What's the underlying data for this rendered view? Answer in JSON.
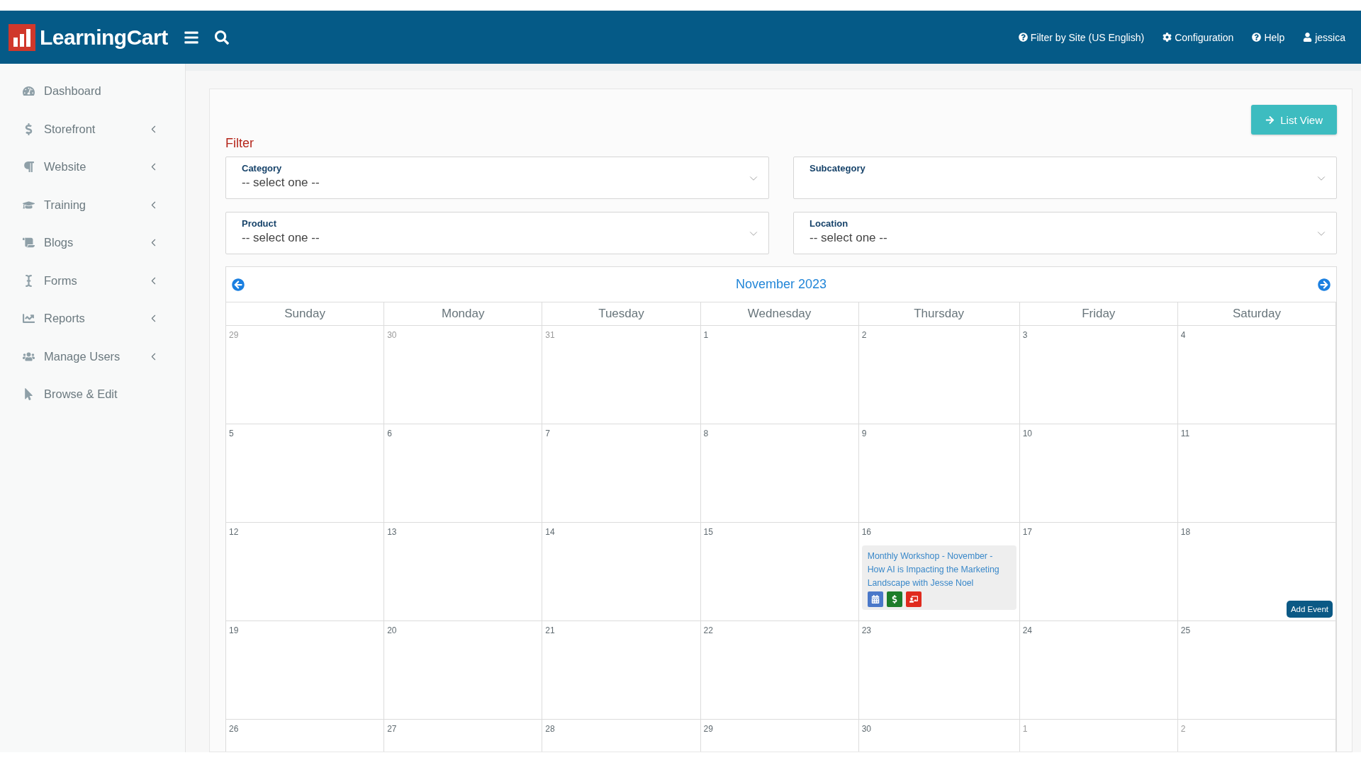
{
  "header": {
    "logo": "LearningCart",
    "links": [
      {
        "label": "Filter by Site (US English)"
      },
      {
        "label": "Configuration"
      },
      {
        "label": "Help"
      },
      {
        "label": "jessica"
      }
    ]
  },
  "sidebar": {
    "items": [
      {
        "label": "Dashboard",
        "expandable": false
      },
      {
        "label": "Storefront",
        "expandable": true
      },
      {
        "label": "Website",
        "expandable": true
      },
      {
        "label": "Training",
        "expandable": true
      },
      {
        "label": "Blogs",
        "expandable": true
      },
      {
        "label": "Forms",
        "expandable": true
      },
      {
        "label": "Reports",
        "expandable": true
      },
      {
        "label": "Manage Users",
        "expandable": true
      },
      {
        "label": "Browse & Edit",
        "expandable": false
      }
    ]
  },
  "list_view_button": "List View",
  "filter": {
    "title": "Filter",
    "fields": [
      {
        "label": "Category",
        "value": "-- select one --"
      },
      {
        "label": "Subcategory"
      },
      {
        "label": "Product",
        "value": "-- select one --"
      },
      {
        "label": "Location",
        "value": "-- select one --"
      }
    ]
  },
  "calendar": {
    "month": "November 2023",
    "weekdays": [
      "Sunday",
      "Monday",
      "Tuesday",
      "Wednesday",
      "Thursday",
      "Friday",
      "Saturday"
    ],
    "weeks": [
      [
        {
          "day": "29",
          "other_month": true
        },
        {
          "day": "30",
          "other_month": true
        },
        {
          "day": "31",
          "other_month": true
        },
        {
          "day": "1",
          "other_month": false
        },
        {
          "day": "2",
          "other_month": false
        },
        {
          "day": "3",
          "other_month": false
        },
        {
          "day": "4",
          "other_month": false
        }
      ],
      [
        {
          "day": "5",
          "other_month": false
        },
        {
          "day": "6",
          "other_month": false
        },
        {
          "day": "7",
          "other_month": false
        },
        {
          "day": "8",
          "other_month": false
        },
        {
          "day": "9",
          "other_month": false
        },
        {
          "day": "10",
          "other_month": false
        },
        {
          "day": "11",
          "other_month": false
        }
      ],
      [
        {
          "day": "12",
          "other_month": false
        },
        {
          "day": "13",
          "other_month": false
        },
        {
          "day": "14",
          "other_month": false
        },
        {
          "day": "15",
          "other_month": false
        },
        {
          "day": "16",
          "other_month": false,
          "events": [
            {
              "title": "Monthly Workshop - November - How AI is Impacting the Marketing Landscape with Jesse Noel",
              "badges": [
                {
                  "kind": "calendar"
                },
                {
                  "kind": "price"
                },
                {
                  "kind": "presentation"
                }
              ]
            }
          ]
        },
        {
          "day": "17",
          "other_month": false
        },
        {
          "day": "18",
          "other_month": false,
          "add_event": "Add Event"
        }
      ],
      [
        {
          "day": "19",
          "other_month": false
        },
        {
          "day": "20",
          "other_month": false
        },
        {
          "day": "21",
          "other_month": false
        },
        {
          "day": "22",
          "other_month": false
        },
        {
          "day": "23",
          "other_month": false
        },
        {
          "day": "24",
          "other_month": false
        },
        {
          "day": "25",
          "other_month": false
        }
      ],
      [
        {
          "day": "26",
          "other_month": false
        },
        {
          "day": "27",
          "other_month": false
        },
        {
          "day": "28",
          "other_month": false
        },
        {
          "day": "29",
          "other_month": false
        },
        {
          "day": "30",
          "other_month": false
        },
        {
          "day": "1",
          "other_month": true
        },
        {
          "day": "2",
          "other_month": true
        }
      ]
    ]
  }
}
